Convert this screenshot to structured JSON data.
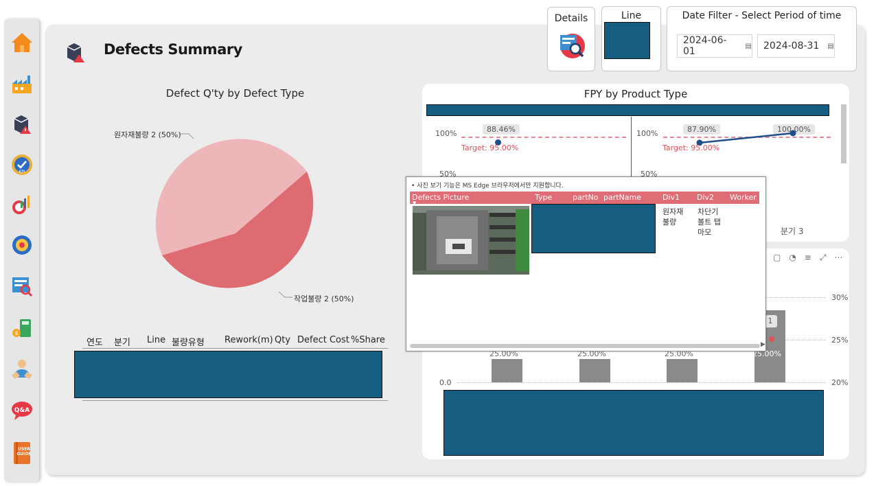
{
  "page": {
    "title": "Defects Summary"
  },
  "sidebar": {
    "items": [
      {
        "name": "home"
      },
      {
        "name": "factory"
      },
      {
        "name": "defects"
      },
      {
        "name": "kpi"
      },
      {
        "name": "productivity"
      },
      {
        "name": "settings"
      },
      {
        "name": "inspection"
      },
      {
        "name": "cost"
      },
      {
        "name": "worker"
      },
      {
        "name": "qa"
      },
      {
        "name": "user-guide"
      }
    ],
    "kpi_label": "KPI",
    "qa_label": "Q&A",
    "guide_label": "USER GUIDE"
  },
  "toolbar": {
    "details_label": "Details",
    "line_label": "Line",
    "date_filter_label": "Date Filter - Select Period of time",
    "date_start": "2024-06-01",
    "date_end": "2024-08-31"
  },
  "pie": {
    "title": "Defect Q'ty by Defect Type",
    "label_a": "원자재불량 2 (50%)",
    "label_b": "작업불량 2 (50%)",
    "colors": {
      "a": "#eeb6b9",
      "b": "#de6b71"
    }
  },
  "table": {
    "headers": [
      "연도",
      "분기",
      "Line",
      "불량유형",
      "Rework(m)",
      "Qty",
      "Defect Cost",
      "%Share"
    ]
  },
  "fpy": {
    "title": "FPY by Product Type",
    "y_top": "100%",
    "y_mid": "50%",
    "left_value": "88.46%",
    "right_value_a": "87.90%",
    "right_value_b": "100.00%",
    "target": "Target: 95.00%",
    "quarter": "분기 3"
  },
  "lower": {
    "axis_right": [
      "30%",
      "25%",
      "20%"
    ],
    "axis_left_zero": "0.0",
    "bar_labels": [
      "25.00%",
      "25.00%",
      "25.00%",
      "25.00%"
    ],
    "badge": "1"
  },
  "popup": {
    "notice": "• 사진 보기 기능은 MS Edge 브라우저에서만 지원합니다.",
    "headers": [
      "Defects Picture",
      "Type",
      "partNo",
      "partName",
      "Div1",
      "Div2",
      "Worker"
    ],
    "row": {
      "div1": "원자재\n불량",
      "div2": "차단기\n볼트 탭\n마모"
    }
  }
}
